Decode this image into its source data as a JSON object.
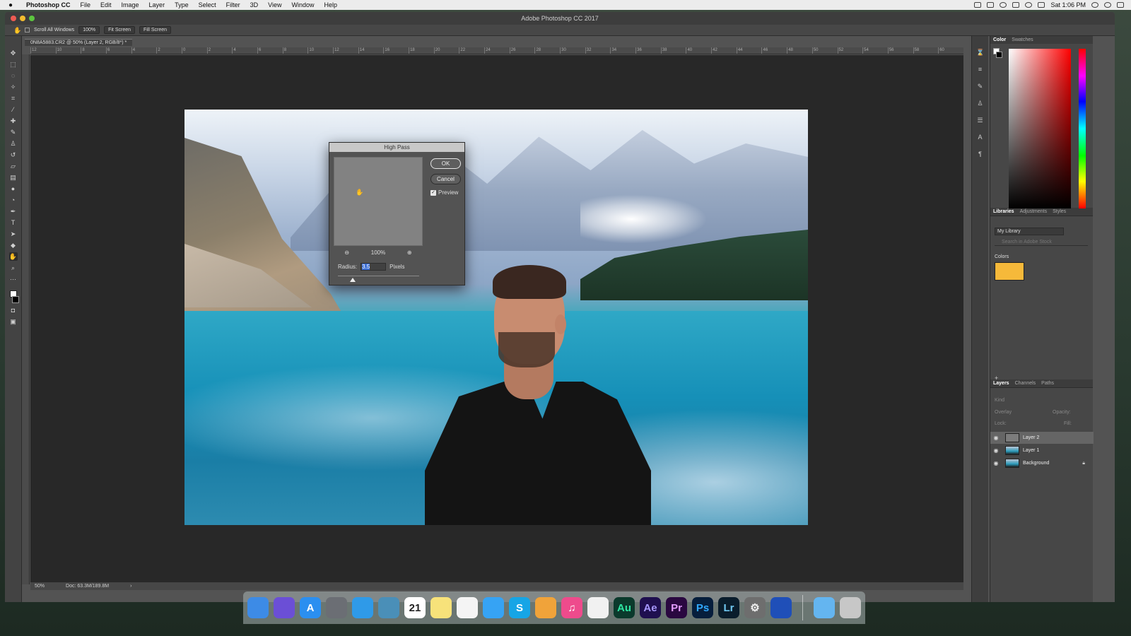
{
  "menubar": {
    "app": "Photoshop CC",
    "items": [
      "File",
      "Edit",
      "Image",
      "Layer",
      "Type",
      "Select",
      "Filter",
      "3D",
      "View",
      "Window",
      "Help"
    ],
    "clock": "Sat 1:06 PM"
  },
  "window": {
    "title": "Adobe Photoshop CC 2017"
  },
  "options": {
    "scroll_all_windows": "Scroll All Windows",
    "zoom_100": "100%",
    "fit_screen": "Fit Screen",
    "fill_screen": "Fill Screen"
  },
  "document": {
    "tab": "0N8A5883.CR2 @ 50% (Layer 2, RGB/8*) *"
  },
  "ruler": {
    "top_ticks": [
      "12",
      "10",
      "8",
      "6",
      "4",
      "2",
      "0",
      "2",
      "4",
      "6",
      "8",
      "10",
      "12",
      "14",
      "16",
      "18",
      "20",
      "22",
      "24",
      "26",
      "28",
      "30",
      "32",
      "34",
      "36",
      "38",
      "40",
      "42",
      "44",
      "46",
      "48",
      "50",
      "52",
      "54",
      "56",
      "58",
      "60"
    ]
  },
  "dialog": {
    "title": "High Pass",
    "ok": "OK",
    "cancel": "Cancel",
    "preview": "Preview",
    "zoom": "100%",
    "radius_label": "Radius:",
    "radius_value": "3.5",
    "radius_unit": "Pixels"
  },
  "panels": {
    "color_tabs": [
      "Color",
      "Swatches"
    ],
    "library_tabs": [
      "Libraries",
      "Adjustments",
      "Styles"
    ],
    "library_select": "My Library",
    "library_search": "Search in Adobe Stock",
    "colors_header": "Colors",
    "layers_tabs": [
      "Layers",
      "Channels",
      "Paths"
    ],
    "layers_filter": "Kind",
    "blend_mode": "Overlay",
    "opacity_label": "Opacity:",
    "lock_label": "Lock:",
    "fill_label": "Fill:",
    "layers": [
      {
        "name": "Layer 2",
        "selected": true
      },
      {
        "name": "Layer 1",
        "selected": false
      },
      {
        "name": "Background",
        "selected": false
      }
    ]
  },
  "statusbar": {
    "zoom": "50%",
    "doc": "Doc: 63.3M/189.8M"
  },
  "dock": {
    "apps": [
      {
        "name": "finder-icon",
        "glyph": "",
        "bg": "#3d8be6",
        "fg": "#ffffff"
      },
      {
        "name": "siri-icon",
        "glyph": "",
        "bg": "#6b4fd6",
        "fg": "#ffffff"
      },
      {
        "name": "app-store-icon",
        "glyph": "A",
        "bg": "#2b8ff0",
        "fg": "#ffffff"
      },
      {
        "name": "launchpad-icon",
        "glyph": "",
        "bg": "#6b6e74",
        "fg": "#ffffff"
      },
      {
        "name": "safari-icon",
        "glyph": "",
        "bg": "#2f9ae8",
        "fg": "#ffffff"
      },
      {
        "name": "preview-icon",
        "glyph": "",
        "bg": "#4a8fb8",
        "fg": "#ffffff"
      },
      {
        "name": "calendar-icon",
        "glyph": "21",
        "bg": "#ffffff",
        "fg": "#222222"
      },
      {
        "name": "notes-icon",
        "glyph": "",
        "bg": "#f7e27a",
        "fg": "#222222"
      },
      {
        "name": "reminders-icon",
        "glyph": "",
        "bg": "#f4f4f4",
        "fg": "#222222"
      },
      {
        "name": "messages-icon",
        "glyph": "",
        "bg": "#36a3f4",
        "fg": "#ffffff"
      },
      {
        "name": "skype-icon",
        "glyph": "S",
        "bg": "#16a5e6",
        "fg": "#ffffff"
      },
      {
        "name": "pages-icon",
        "glyph": "",
        "bg": "#f0a33a",
        "fg": "#ffffff"
      },
      {
        "name": "itunes-icon",
        "glyph": "♫",
        "bg": "#ee4b8c",
        "fg": "#ffffff"
      },
      {
        "name": "photos-icon",
        "glyph": "",
        "bg": "#f1f1f1",
        "fg": "#222222"
      },
      {
        "name": "audition-icon",
        "glyph": "Au",
        "bg": "#0b3a2c",
        "fg": "#2ee6a2"
      },
      {
        "name": "after-effects-icon",
        "glyph": "Ae",
        "bg": "#1f0f4f",
        "fg": "#a798ff"
      },
      {
        "name": "premiere-icon",
        "glyph": "Pr",
        "bg": "#2a0840",
        "fg": "#e39cff"
      },
      {
        "name": "photoshop-icon",
        "glyph": "Ps",
        "bg": "#061e3c",
        "fg": "#30a8ff"
      },
      {
        "name": "lightroom-icon",
        "glyph": "Lr",
        "bg": "#0a1d2c",
        "fg": "#6fc7f0"
      },
      {
        "name": "system-preferences-icon",
        "glyph": "⚙",
        "bg": "#6e6e6e",
        "fg": "#eeeeee"
      },
      {
        "name": "screensharing-icon",
        "glyph": "",
        "bg": "#1f4fb8",
        "fg": "#ffffff"
      }
    ],
    "after_sep": [
      {
        "name": "folder-icon",
        "glyph": "",
        "bg": "#64b5f0",
        "fg": "#ffffff"
      },
      {
        "name": "trash-icon",
        "glyph": "",
        "bg": "#c7c7c7",
        "fg": "#444444"
      }
    ]
  }
}
